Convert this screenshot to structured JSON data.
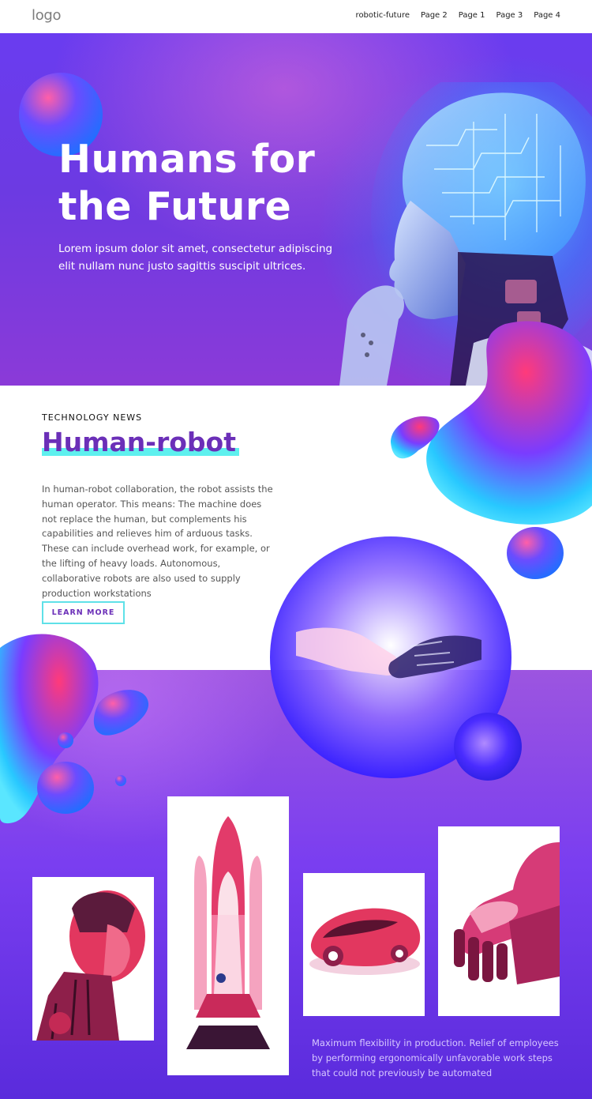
{
  "header": {
    "logo": "logo",
    "nav": [
      {
        "label": "robotic-future"
      },
      {
        "label": "Page 2"
      },
      {
        "label": "Page 1"
      },
      {
        "label": "Page 3"
      },
      {
        "label": "Page 4"
      }
    ]
  },
  "hero": {
    "title": "Humans for the Future",
    "subtitle": "Lorem ipsum dolor sit amet, consectetur adipiscing elit nullam nunc justo sagittis suscipit ultrices."
  },
  "news": {
    "kicker": "TECHNOLOGY NEWS",
    "headline": "Human-robot",
    "body": "In human-robot collaboration, the robot assists the human operator. This means: The machine does not replace the human, but complements his capabilities and relieves him of arduous tasks. These can include overhead work, for example, or the lifting of heavy loads. Autonomous, collaborative robots are also used to supply production workstations",
    "button": "LEARN MORE"
  },
  "gallery": {
    "caption": "Maximum flexibility in production. Relief of employees by performing ergonomically unfavorable work steps that could not previously be automated",
    "images": [
      {
        "icon": "robot-bust-image"
      },
      {
        "icon": "space-shuttle-image"
      },
      {
        "icon": "concept-car-image"
      },
      {
        "icon": "robot-human-hand-image"
      }
    ]
  },
  "colors": {
    "accent": "#6b2fb8",
    "underline": "#5ef0ee",
    "hero_bg": "#6a3cf0"
  }
}
